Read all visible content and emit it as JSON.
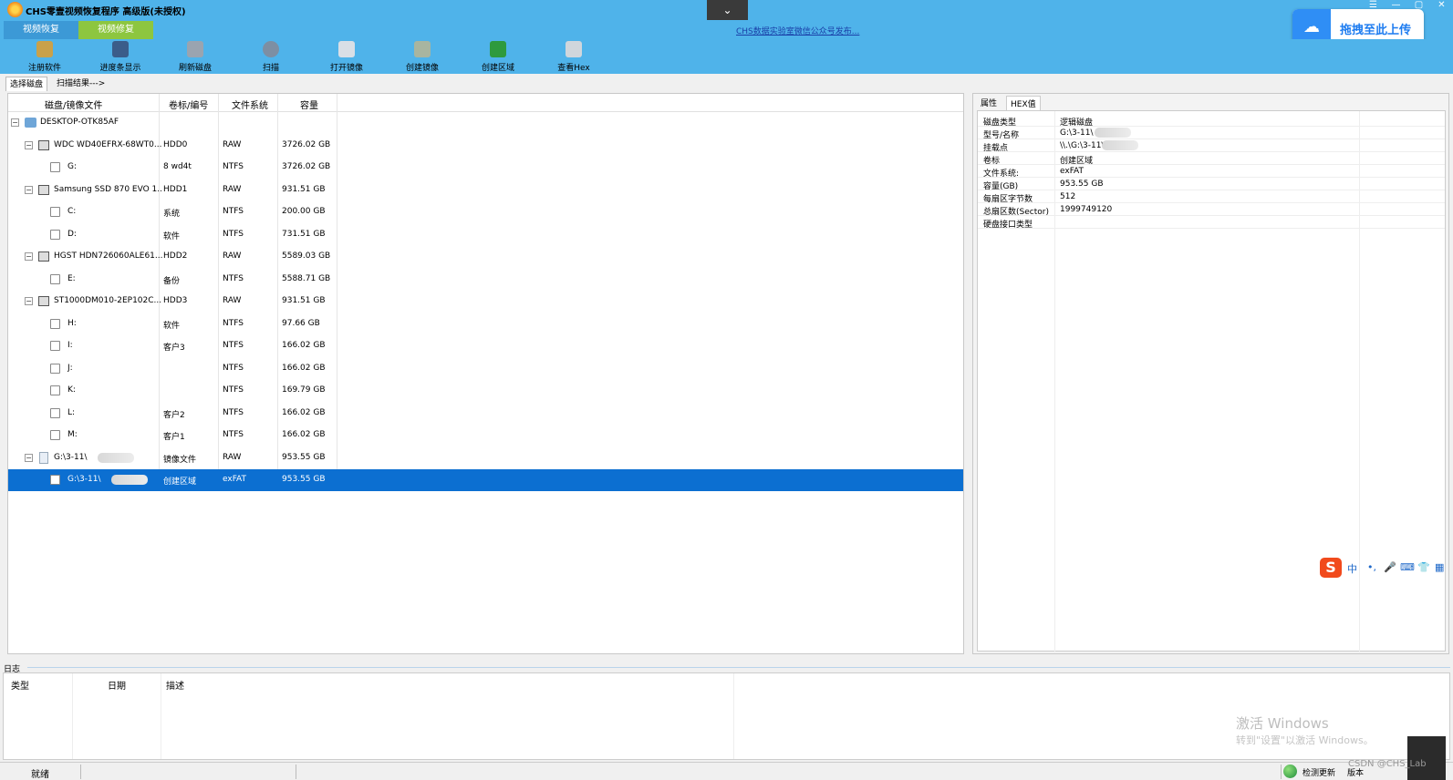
{
  "title_bar": {
    "title": "CHS零壹视频恢复程序 高级版(未授权)",
    "center_button": "⌄",
    "controls": [
      "☰",
      "—",
      "▢",
      "✕"
    ]
  },
  "mode_tabs": [
    {
      "label": "视频恢复"
    },
    {
      "label": "视频修复"
    }
  ],
  "notice_link": "CHS数据实验室微信公众号发布...",
  "upload_widget": {
    "label": "拖拽至此上传"
  },
  "toolbar": [
    {
      "label": "注册软件",
      "icon": "key-icon"
    },
    {
      "label": "进度条显示",
      "icon": "progress-icon"
    },
    {
      "label": "刷新磁盘",
      "icon": "refresh-disk-icon"
    },
    {
      "label": "扫描",
      "icon": "magnifier-icon"
    },
    {
      "label": "打开镜像",
      "icon": "open-image-icon"
    },
    {
      "label": "创建镜像",
      "icon": "create-image-icon"
    },
    {
      "label": "创建区域",
      "icon": "create-region-icon"
    },
    {
      "label": "查看Hex",
      "icon": "hex-view-icon"
    }
  ],
  "sub_tabs": [
    {
      "label": "选择磁盘"
    },
    {
      "label": "扫描结果--->"
    }
  ],
  "disk_table": {
    "columns": [
      "磁盘/镜像文件",
      "卷标/编号",
      "文件系统",
      "容量"
    ],
    "rows": [
      {
        "name": "DESKTOP-OTK85AF",
        "label": "",
        "fs": "",
        "size": ""
      },
      {
        "name": "WDC WD40EFRX-68WT0...",
        "label": "HDD0",
        "fs": "RAW",
        "size": "3726.02 GB"
      },
      {
        "name": "G:",
        "label": "8 wd4t",
        "fs": "NTFS",
        "size": "3726.02 GB"
      },
      {
        "name": "Samsung SSD 870 EVO 1...",
        "label": "HDD1",
        "fs": "RAW",
        "size": "931.51 GB"
      },
      {
        "name": "C:",
        "label": "系统",
        "fs": "NTFS",
        "size": "200.00 GB"
      },
      {
        "name": "D:",
        "label": "软件",
        "fs": "NTFS",
        "size": "731.51 GB"
      },
      {
        "name": "HGST HDN726060ALE61...",
        "label": "HDD2",
        "fs": "RAW",
        "size": "5589.03 GB"
      },
      {
        "name": "E:",
        "label": "备份",
        "fs": "NTFS",
        "size": "5588.71 GB"
      },
      {
        "name": "ST1000DM010-2EP102C...",
        "label": "HDD3",
        "fs": "RAW",
        "size": "931.51 GB"
      },
      {
        "name": "H:",
        "label": "软件",
        "fs": "NTFS",
        "size": "97.66 GB"
      },
      {
        "name": "I:",
        "label": "客户3",
        "fs": "NTFS",
        "size": "166.02 GB"
      },
      {
        "name": "J:",
        "label": "",
        "fs": "NTFS",
        "size": "166.02 GB"
      },
      {
        "name": "K:",
        "label": "",
        "fs": "NTFS",
        "size": "169.79 GB"
      },
      {
        "name": "L:",
        "label": "客户2",
        "fs": "NTFS",
        "size": "166.02 GB"
      },
      {
        "name": "M:",
        "label": "客户1",
        "fs": "NTFS",
        "size": "166.02 GB"
      },
      {
        "name": "G:\\3-11\\",
        "label": "镜像文件",
        "fs": "RAW",
        "size": "953.55 GB"
      },
      {
        "name": "G:\\3-11\\",
        "label": "创建区域",
        "fs": "exFAT",
        "size": "953.55 GB"
      }
    ]
  },
  "properties": {
    "tabs": [
      "属性",
      "HEX值"
    ],
    "rows": [
      {
        "key": "磁盘类型",
        "value": "逻辑磁盘"
      },
      {
        "key": "型号/名称",
        "value": "G:\\3-11\\"
      },
      {
        "key": "挂载点",
        "value": "\\\\.\\G:\\3-11\\"
      },
      {
        "key": "卷标",
        "value": "创建区域"
      },
      {
        "key": "文件系统:",
        "value": "exFAT"
      },
      {
        "key": "容量(GB)",
        "value": "953.55 GB"
      },
      {
        "key": "每扇区字节数",
        "value": "512"
      },
      {
        "key": "总扇区数(Sector)",
        "value": "1999749120"
      },
      {
        "key": "硬盘接口类型",
        "value": ""
      }
    ]
  },
  "ime_bar": {
    "logo": "S",
    "items": [
      "中",
      "•,",
      "🎤",
      "⌨",
      "👕",
      "▦"
    ]
  },
  "log": {
    "title": "日志",
    "columns": [
      "类型",
      "日期",
      "描述"
    ]
  },
  "watermark": {
    "line1": "激活 Windows",
    "line2": "转到\"设置\"以激活 Windows。"
  },
  "status_bar": {
    "ready": "就绪",
    "check_update": "检测更新",
    "new_version": "版本"
  },
  "csdn_mark": "CSDN @CHS_Lab",
  "colors": {
    "chrome": "#4fb3ea",
    "selection": "#0c6fd1",
    "tab_green": "#8dc63f"
  }
}
